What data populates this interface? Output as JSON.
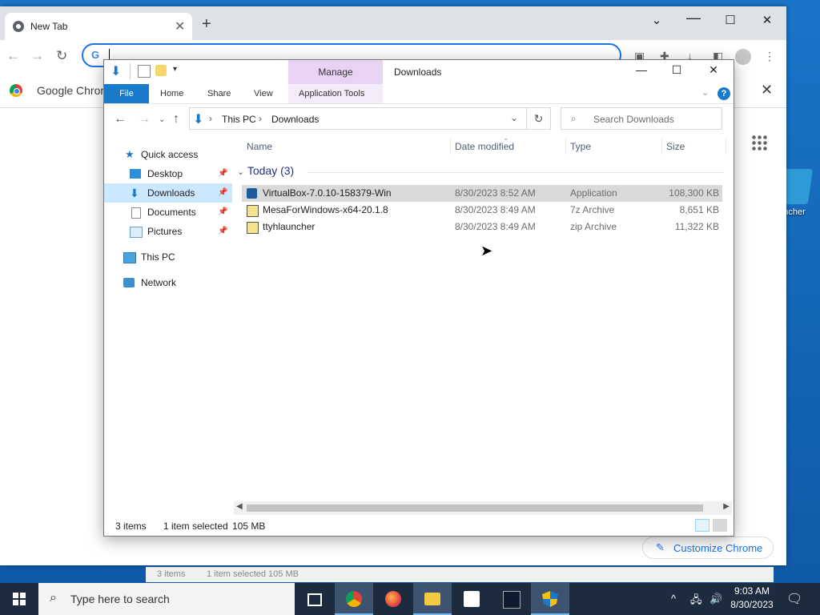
{
  "desktop": {
    "icon_label": "ncher"
  },
  "chrome": {
    "tab_title": "New Tab",
    "new_tab_symbol": "+",
    "close_tab_symbol": "✕",
    "window_controls": {
      "minimize": "⌄",
      "maximize": "☐",
      "close": "✕"
    },
    "omnibox_value": "",
    "omnibox_g": "G",
    "infobar_text": "Google Chrom",
    "customize_label": "Customize Chrome",
    "ghost_status": {
      "items": "3 items",
      "selected": "1 item selected  105 MB"
    }
  },
  "explorer": {
    "title": "Downloads",
    "manage_label": "Manage",
    "ribbon_tabs": [
      "File",
      "Home",
      "Share",
      "View",
      "Application Tools"
    ],
    "window_controls": {
      "minimize": "—",
      "maximize": "☐",
      "close": "✕"
    },
    "breadcrumb": [
      "This PC",
      "Downloads"
    ],
    "search_placeholder": "Search Downloads",
    "nav": {
      "quick_access": "Quick access",
      "desktop": "Desktop",
      "downloads": "Downloads",
      "documents": "Documents",
      "pictures": "Pictures",
      "this_pc": "This PC",
      "network": "Network"
    },
    "columns": {
      "name": "Name",
      "date": "Date modified",
      "type": "Type",
      "size": "Size"
    },
    "group": "Today (3)",
    "files": [
      {
        "name": "VirtualBox-7.0.10-158379-Win",
        "date": "8/30/2023 8:52 AM",
        "type": "Application",
        "size": "108,300 KB"
      },
      {
        "name": "MesaForWindows-x64-20.1.8",
        "date": "8/30/2023 8:49 AM",
        "type": "7z Archive",
        "size": "8,651 KB"
      },
      {
        "name": "ttyhlauncher",
        "date": "8/30/2023 8:49 AM",
        "type": "zip Archive",
        "size": "11,322 KB"
      }
    ],
    "status": {
      "items": "3 items",
      "selected": "1 item selected",
      "size": "105 MB"
    }
  },
  "taskbar": {
    "search_placeholder": "Type here to search",
    "time": "9:03 AM",
    "date": "8/30/2023"
  },
  "colors": {
    "accent": "#1979ca",
    "selection": "#cce8ff",
    "manage": "#e8d3f5",
    "taskbar": "#1c2b3d"
  }
}
